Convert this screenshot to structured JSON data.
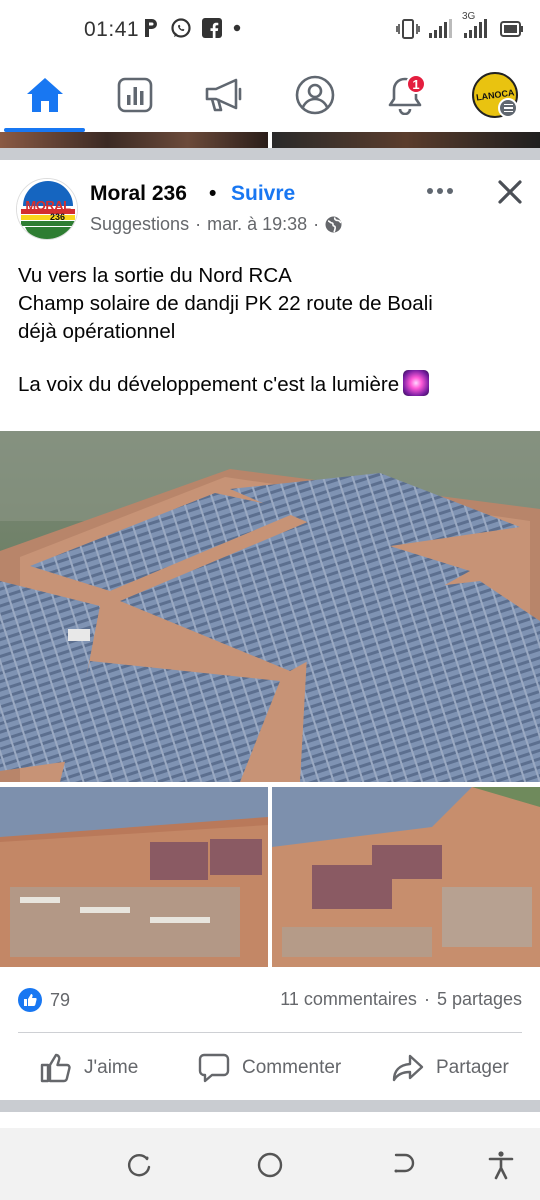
{
  "status_bar": {
    "time": "01:41",
    "network_label": "3G",
    "icons": [
      "parking-icon",
      "whatsapp-icon",
      "facebook-icon",
      "dot-icon",
      "vibrate-icon",
      "signal-icon",
      "battery-icon"
    ]
  },
  "nav": {
    "active_color": "#1877f2",
    "items": [
      "home-icon",
      "feeds-icon",
      "megaphone-icon",
      "profile-icon",
      "bell-icon",
      "menu-avatar"
    ],
    "notification_count": "1",
    "menu_avatar_text": "LANOCA"
  },
  "post": {
    "author": "Moral 236",
    "separator": "•",
    "follow_label": "Suivre",
    "meta_source": "Suggestions",
    "meta_dot": "·",
    "meta_time": "mar. à 19:38",
    "meta_dot2": "·",
    "avatar_text_top": "MORAL",
    "avatar_text_bottom": "236",
    "text_lines": [
      "Vu vers la sortie du Nord RCA",
      "Champ solaire de dandji PK 22 route de Boali",
      "déjà opérationnel",
      "La voix du développement c'est la lumière"
    ],
    "reaction_count": "79",
    "comments": "11 commentaires",
    "stats_dot": "·",
    "shares": "5 partages",
    "actions": {
      "like": "J'aime",
      "comment": "Commenter",
      "share": "Partager"
    }
  },
  "colors": {
    "brand": "#1877f2",
    "text_secondary": "#65676b",
    "badge": "#e41e3f",
    "separator": "#c9ccd1"
  }
}
